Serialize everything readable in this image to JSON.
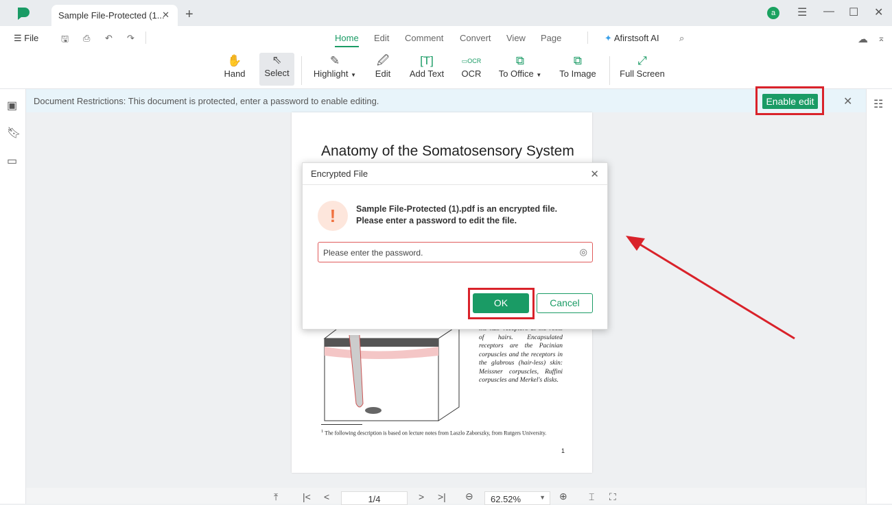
{
  "app": {
    "tab_title": "Sample File-Protected (1...",
    "avatar_letter": "a",
    "accent": "#1a9b65"
  },
  "menu": {
    "file": "File",
    "tabs": [
      "Home",
      "Edit",
      "Comment",
      "Convert",
      "View",
      "Page"
    ],
    "active": "Home",
    "ai": "Afirstsoft AI"
  },
  "tools": [
    {
      "label": "Hand",
      "icon": "hand-icon"
    },
    {
      "label": "Select",
      "icon": "cursor-icon"
    },
    {
      "label": "Highlight",
      "icon": "highlighter-icon"
    },
    {
      "label": "Edit",
      "icon": "edit-icon"
    },
    {
      "label": "Add Text",
      "icon": "add-text-icon"
    },
    {
      "label": "OCR",
      "icon": "ocr-icon"
    },
    {
      "label": "To Office",
      "icon": "to-office-icon"
    },
    {
      "label": "To Image",
      "icon": "to-image-icon"
    },
    {
      "label": "Full Screen",
      "icon": "fullscreen-icon"
    }
  ],
  "restriction": {
    "text": "Document Restrictions: This document is protected, enter a password to enable editing.",
    "button": "Enable edit"
  },
  "document": {
    "title": "Anatomy of the Somatosensory System",
    "body": "the hair receptors at the roots of hairs. Encapsulated receptors are the Pacinian corpuscles and the receptors in the glabrous (hair-less) skin: Meissner corpuscles, Ruffini corpuscles and Merkel's disks.",
    "footnote_mark": "1",
    "footnote": "The following description is based on lecture notes from Laszlo Zaborszky, from Rutgers University.",
    "page_number": "1"
  },
  "dialog": {
    "title": "Encrypted File",
    "line1": "Sample File-Protected (1).pdf  is an encrypted file.",
    "line2": "Please enter a password to edit the file.",
    "placeholder": "Please enter the password.",
    "ok": "OK",
    "cancel": "Cancel"
  },
  "nav": {
    "page": "1/4",
    "zoom": "62.52%"
  }
}
